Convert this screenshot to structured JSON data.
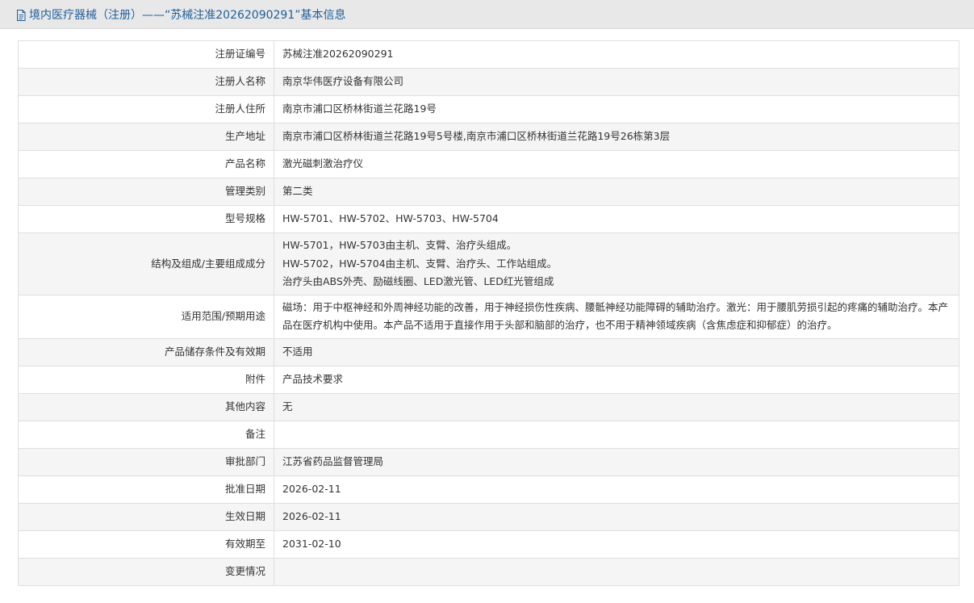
{
  "header": {
    "title": "境内医疗器械（注册）——“苏械注准20262090291”基本信息",
    "icon": "document-icon"
  },
  "rows": [
    {
      "label": "注册证编号",
      "value": "苏械注准20262090291"
    },
    {
      "label": "注册人名称",
      "value": "南京华伟医疗设备有限公司"
    },
    {
      "label": "注册人住所",
      "value": "南京市浦口区桥林街道兰花路19号"
    },
    {
      "label": "生产地址",
      "value": "南京市浦口区桥林街道兰花路19号5号楼,南京市浦口区桥林街道兰花路19号26栋第3层"
    },
    {
      "label": "产品名称",
      "value": "激光磁刺激治疗仪"
    },
    {
      "label": "管理类别",
      "value": "第二类"
    },
    {
      "label": "型号规格",
      "value": "HW-5701、HW-5702、HW-5703、HW-5704"
    },
    {
      "label": "结构及组成/主要组成成分",
      "lines": [
        "HW-5701，HW-5703由主机、支臂、治疗头组成。",
        "HW-5702，HW-5704由主机、支臂、治疗头、工作站组成。",
        "治疗头由ABS外壳、励磁线圈、LED激光管、LED红光管组成"
      ]
    },
    {
      "label": "适用范围/预期用途",
      "value": "磁场：用于中枢神经和外周神经功能的改善，用于神经损伤性疾病、腰骶神经功能障碍的辅助治疗。激光：用于腰肌劳损引起的疼痛的辅助治疗。本产品在医疗机构中使用。本产品不适用于直接作用于头部和脑部的治疗，也不用于精神领域疾病（含焦虑症和抑郁症）的治疗。"
    },
    {
      "label": "产品储存条件及有效期",
      "value": "不适用"
    },
    {
      "label": "附件",
      "value": "产品技术要求"
    },
    {
      "label": "其他内容",
      "value": "无"
    },
    {
      "label": "备注",
      "value": ""
    },
    {
      "label": "审批部门",
      "value": "江苏省药品监督管理局"
    },
    {
      "label": "批准日期",
      "value": "2026-02-11"
    },
    {
      "label": "生效日期",
      "value": "2026-02-11"
    },
    {
      "label": "有效期至",
      "value": "2031-02-10"
    },
    {
      "label": "变更情况",
      "value": ""
    }
  ]
}
